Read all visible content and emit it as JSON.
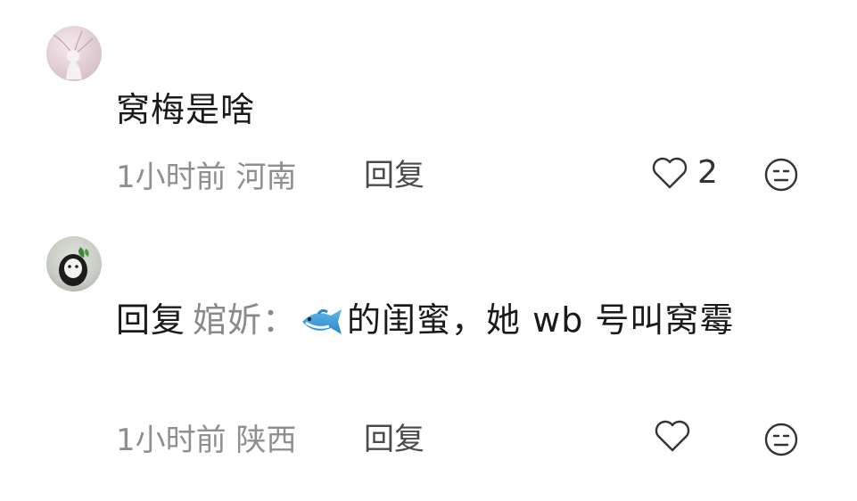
{
  "comments": [
    {
      "text": "窝梅是啥",
      "meta": "1小时前 河南",
      "reply_label": "回复",
      "like_count": "2"
    },
    {
      "reply_prefix": "回复",
      "reply_to": "婠妡：",
      "text_after": "的闺蜜，她 wb 号叫窝霉",
      "emoji": "fish-emoji",
      "meta": "1小时前 陕西",
      "reply_label": "回复",
      "like_count": ""
    }
  ]
}
